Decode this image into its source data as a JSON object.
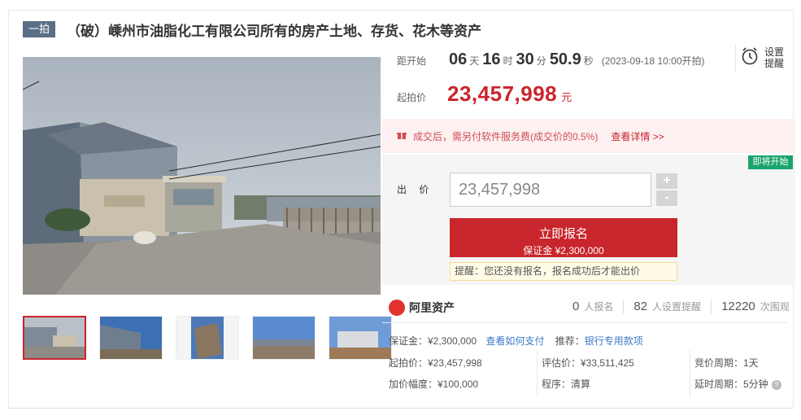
{
  "title": {
    "round_tag": "一拍",
    "text": "（破）嵊州市油脂化工有限公司所有的房产土地、存货、花木等资产"
  },
  "countdown": {
    "label": "距开始",
    "days": "06",
    "days_unit": "天",
    "hours": "16",
    "hours_unit": "时",
    "minutes": "30",
    "minutes_unit": "分",
    "seconds": "50.9",
    "seconds_unit": "秒",
    "start_time": "(2023-09-18 10:00开拍)"
  },
  "remind": {
    "line1": "设置",
    "line2": "提醒",
    "icon": "alarm-clock-icon"
  },
  "start_price": {
    "label": "起拍价",
    "value": "23,457,998",
    "unit": "元"
  },
  "notice": {
    "text": "成交后，需另付软件服务费(成交价的0.5%)",
    "more": "查看详情 >>"
  },
  "status_badge": "即将开始",
  "bid": {
    "label": "出 价",
    "input_value": "23,457,998",
    "plus": "+",
    "minus": "-",
    "register_main": "立即报名",
    "register_sub": "保证金 ¥2,300,000",
    "tip": "提醒：您还没有报名，报名成功后才能出价"
  },
  "platform": {
    "name": "阿里资产"
  },
  "stats": [
    {
      "n": "0",
      "label": "人报名"
    },
    {
      "n": "82",
      "label": "人设置提醒"
    },
    {
      "n": "12220",
      "label": "次围观"
    }
  ],
  "details": {
    "deposit": "保证金：¥2,300,000",
    "deposit_link": "查看如何支付",
    "recommend": "推荐：",
    "recommend_link": "银行专用款项",
    "start_price": "起拍价：¥23,457,998",
    "appraisal": "评估价：¥33,511,425",
    "cycle": "竞价周期：1天",
    "increment": "加价幅度：¥100,000",
    "procedure": "程序：清算",
    "delay": "延时周期：5分钟"
  },
  "colors": {
    "accent": "#c9252c",
    "tag_bg": "#5b6f86",
    "badge_green": "#1aa36b",
    "link": "#3c78c8"
  }
}
